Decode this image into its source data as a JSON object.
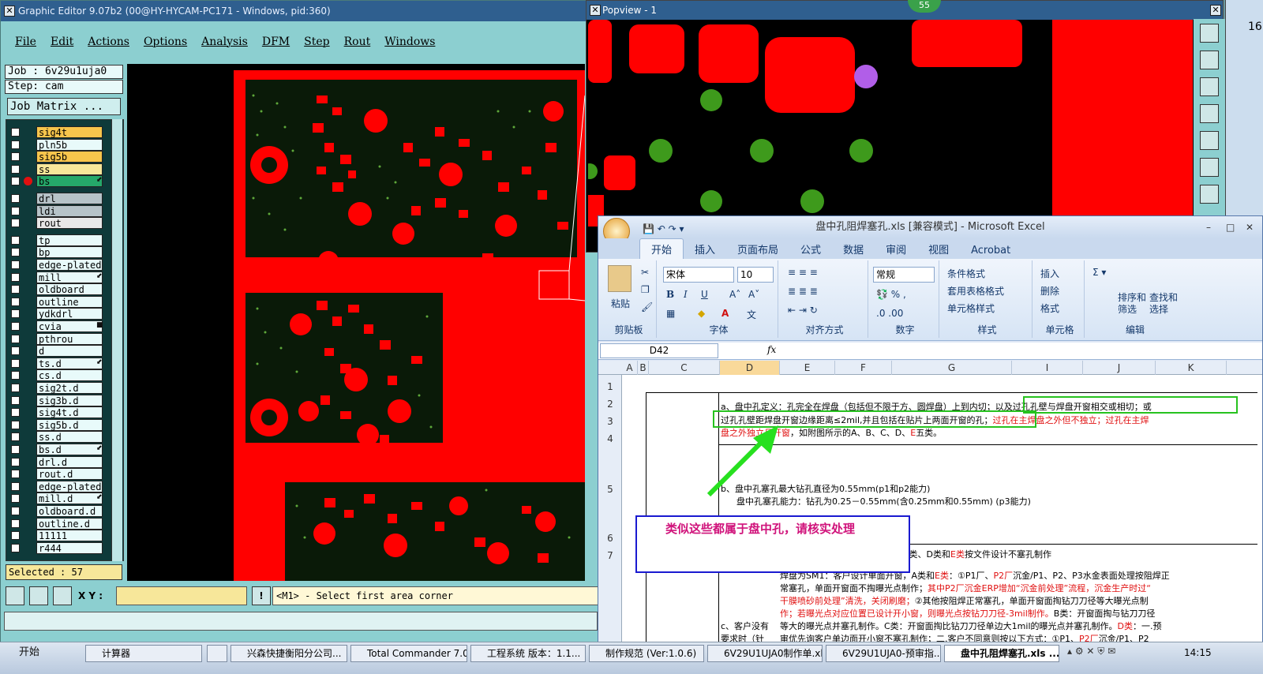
{
  "ge": {
    "title": "Graphic Editor 9.07b2 (00@HY-HYCAM-PC171 - Windows, pid:360)",
    "menu": [
      "File",
      "Edit",
      "Actions",
      "Options",
      "Analysis",
      "DFM",
      "Step",
      "Rout",
      "Windows"
    ],
    "job": "Job : 6v29u1uja0",
    "step": "Step: cam",
    "job_matrix": "Job Matrix ...",
    "layers": [
      {
        "name": "sig4t",
        "color": "#f7c54c"
      },
      {
        "name": "pln5b",
        "color": "#e8fafa"
      },
      {
        "name": "sig5b",
        "color": "#f7c54c"
      },
      {
        "name": "ss",
        "color": "#f7e79a"
      },
      {
        "name": "bs",
        "color": "#25a86a",
        "mark": "⬋"
      },
      {
        "name": "drl",
        "color": "#b6c3c8"
      },
      {
        "name": "ldi",
        "color": "#b6c3c8"
      },
      {
        "name": "rout",
        "color": "#e8e8e8"
      },
      {
        "name": "tp",
        "color": "#e8fafa"
      },
      {
        "name": "bp",
        "color": "#e8fafa"
      },
      {
        "name": "edge-plated",
        "color": "#e8fafa"
      },
      {
        "name": "mill",
        "color": "#e8fafa",
        "mark": "⬋"
      },
      {
        "name": "oldboard",
        "color": "#e8fafa"
      },
      {
        "name": "outline",
        "color": "#e8fafa"
      },
      {
        "name": "ydkdrl",
        "color": "#e8fafa"
      },
      {
        "name": "cvia",
        "color": "#e8fafa",
        "mark": "■"
      },
      {
        "name": "pthrou",
        "color": "#e8fafa"
      },
      {
        "name": "d",
        "color": "#e8fafa"
      },
      {
        "name": "ts.d",
        "color": "#e8fafa",
        "mark": "⬋"
      },
      {
        "name": "cs.d",
        "color": "#e8fafa"
      },
      {
        "name": "sig2t.d",
        "color": "#e8fafa"
      },
      {
        "name": "sig3b.d",
        "color": "#e8fafa"
      },
      {
        "name": "sig4t.d",
        "color": "#e8fafa"
      },
      {
        "name": "sig5b.d",
        "color": "#e8fafa"
      },
      {
        "name": "ss.d",
        "color": "#e8fafa"
      },
      {
        "name": "bs.d",
        "color": "#e8fafa",
        "mark": "⬋"
      },
      {
        "name": "drl.d",
        "color": "#e8fafa"
      },
      {
        "name": "rout.d",
        "color": "#e8fafa"
      },
      {
        "name": "edge-plated",
        "color": "#e8fafa"
      },
      {
        "name": "mill.d",
        "color": "#e8fafa",
        "mark": "⬋"
      },
      {
        "name": "oldboard.d",
        "color": "#e8fafa"
      },
      {
        "name": "outline.d",
        "color": "#e8fafa"
      },
      {
        "name": "11111",
        "color": "#e8fafa"
      },
      {
        "name": "r444",
        "color": "#e8fafa"
      }
    ],
    "selected": "Selected : 57",
    "xy_label": "X Y :",
    "message": "<M1> - Select first area corner"
  },
  "popview": {
    "title": "Popview - 1",
    "badge": "55",
    "right_digit": "16"
  },
  "excel": {
    "title": "盘中孔阻焊塞孔.xls  [兼容模式] - Microsoft Excel",
    "tabs": [
      "开始",
      "插入",
      "页面布局",
      "公式",
      "数据",
      "审阅",
      "视图",
      "Acrobat"
    ],
    "groups": {
      "clipboard": "剪贴板",
      "paste": "粘贴",
      "font": "字体",
      "font_name": "宋体",
      "font_size": "10",
      "align": "对齐方式",
      "number": "数字",
      "number_format": "常规",
      "styles": "样式",
      "cond_format": "条件格式",
      "table_format": "套用表格格式",
      "cell_style": "单元格样式",
      "cells": "单元格",
      "insert": "插入",
      "delete": "删除",
      "format": "格式",
      "edit": "编辑",
      "sort": "排序和\n筛选",
      "find": "查找和\n选择"
    },
    "namebox": "D42",
    "fx": "fx",
    "columns": [
      "A",
      "B",
      "C",
      "D",
      "E",
      "F",
      "G",
      "I",
      "J",
      "K"
    ],
    "rows": [
      "1",
      "2",
      "3",
      "4",
      "5",
      "6",
      "7"
    ],
    "text_a1": "a、盘中孔定义：孔完全在焊盘（包括但不限于方、圆焊盘）上到内切；以及过孔孔壁与焊盘开窗相交或相切；或",
    "text_a2_black": "过孔孔壁距焊盘开窗边缘距离≤2mil,并且包括在贴片上两面开窗的孔；",
    "text_a2_red": "过孔在主焊盘之外但不独立；过孔在主焊",
    "text_a3_red": "盘之外独立且开窗",
    "text_a3_black": "，如附图所示的A、B、C、D、",
    "text_a3_red2": "E",
    "text_a3_black2": "五类。",
    "text_b1": "b、盘中孔塞孔最大钻孔直径为0.55mm(p1和p2能力)",
    "text_b2": "盘中孔塞孔能力：钻孔为0.25－0.55mm(含0.25mm和0.55mm)  (p3能力)",
    "text_r7": "窗，A类、D类和",
    "text_r7_red": "E类",
    "text_r7_b": "按文件设计不塞孔制作",
    "text_c1": "焊盘为SM1：客户设计单面开窗，A类和",
    "text_c1_red": "E类",
    "text_c1_b": "：①P1厂、",
    "text_c1_red2": "P2厂",
    "text_c1_c": "沉金/P1、P2、P3水金表面处理按阻焊正",
    "text_c2": "常塞孔，单面开窗面不掏曝光点制作；",
    "text_c2_red": "其中P2厂沉金ERP增加“沉金前处理”流程，沉金生产时过“",
    "text_c3_red": "干膜喷砂前处理”清洗，关闭刷磨；",
    "text_c3": "②其他按阻焊正常塞孔，单面开窗面掏钻刀刀径等大曝光点制",
    "text_c4_red": "作；若曝光点对应位置已设计开小窗，则曝光点按钻刀刀径-3mil制作。",
    "text_c4": "B类：开窗面掏与钻刀刀径",
    "text_c5": "等大的曝光点并塞孔制作。C类：开窗面掏比钻刀刀径单边大1mil的曝光点并塞孔制作。",
    "text_c5_red": "D类",
    "text_c5_b": "：一.预",
    "text_c6": "审优先询客户单边面开小窗不塞孔制作；二.客户不同意则按以下方式：①P1、",
    "text_c6_red": "P2厂",
    "text_c6_b": "沉金/P1、P2",
    "text_left_c": "c、客户没有",
    "text_left_c2": "要求时（针",
    "note": "类似这些都属于盘中孔，请核实处理"
  },
  "taskbar": {
    "start": "开始",
    "tasks": [
      "计算器",
      "",
      "兴森快捷衡阳分公司...",
      "Total Commander 7.0 ...",
      "工程系统  版本：1.1...",
      "制作规范 (Ver:1.0.6)",
      "6V29U1UJA0制作单.xl...",
      "6V29U1UJA0-预审指...",
      "盘中孔阻焊塞孔.xls ..."
    ],
    "clock": "14:15"
  }
}
